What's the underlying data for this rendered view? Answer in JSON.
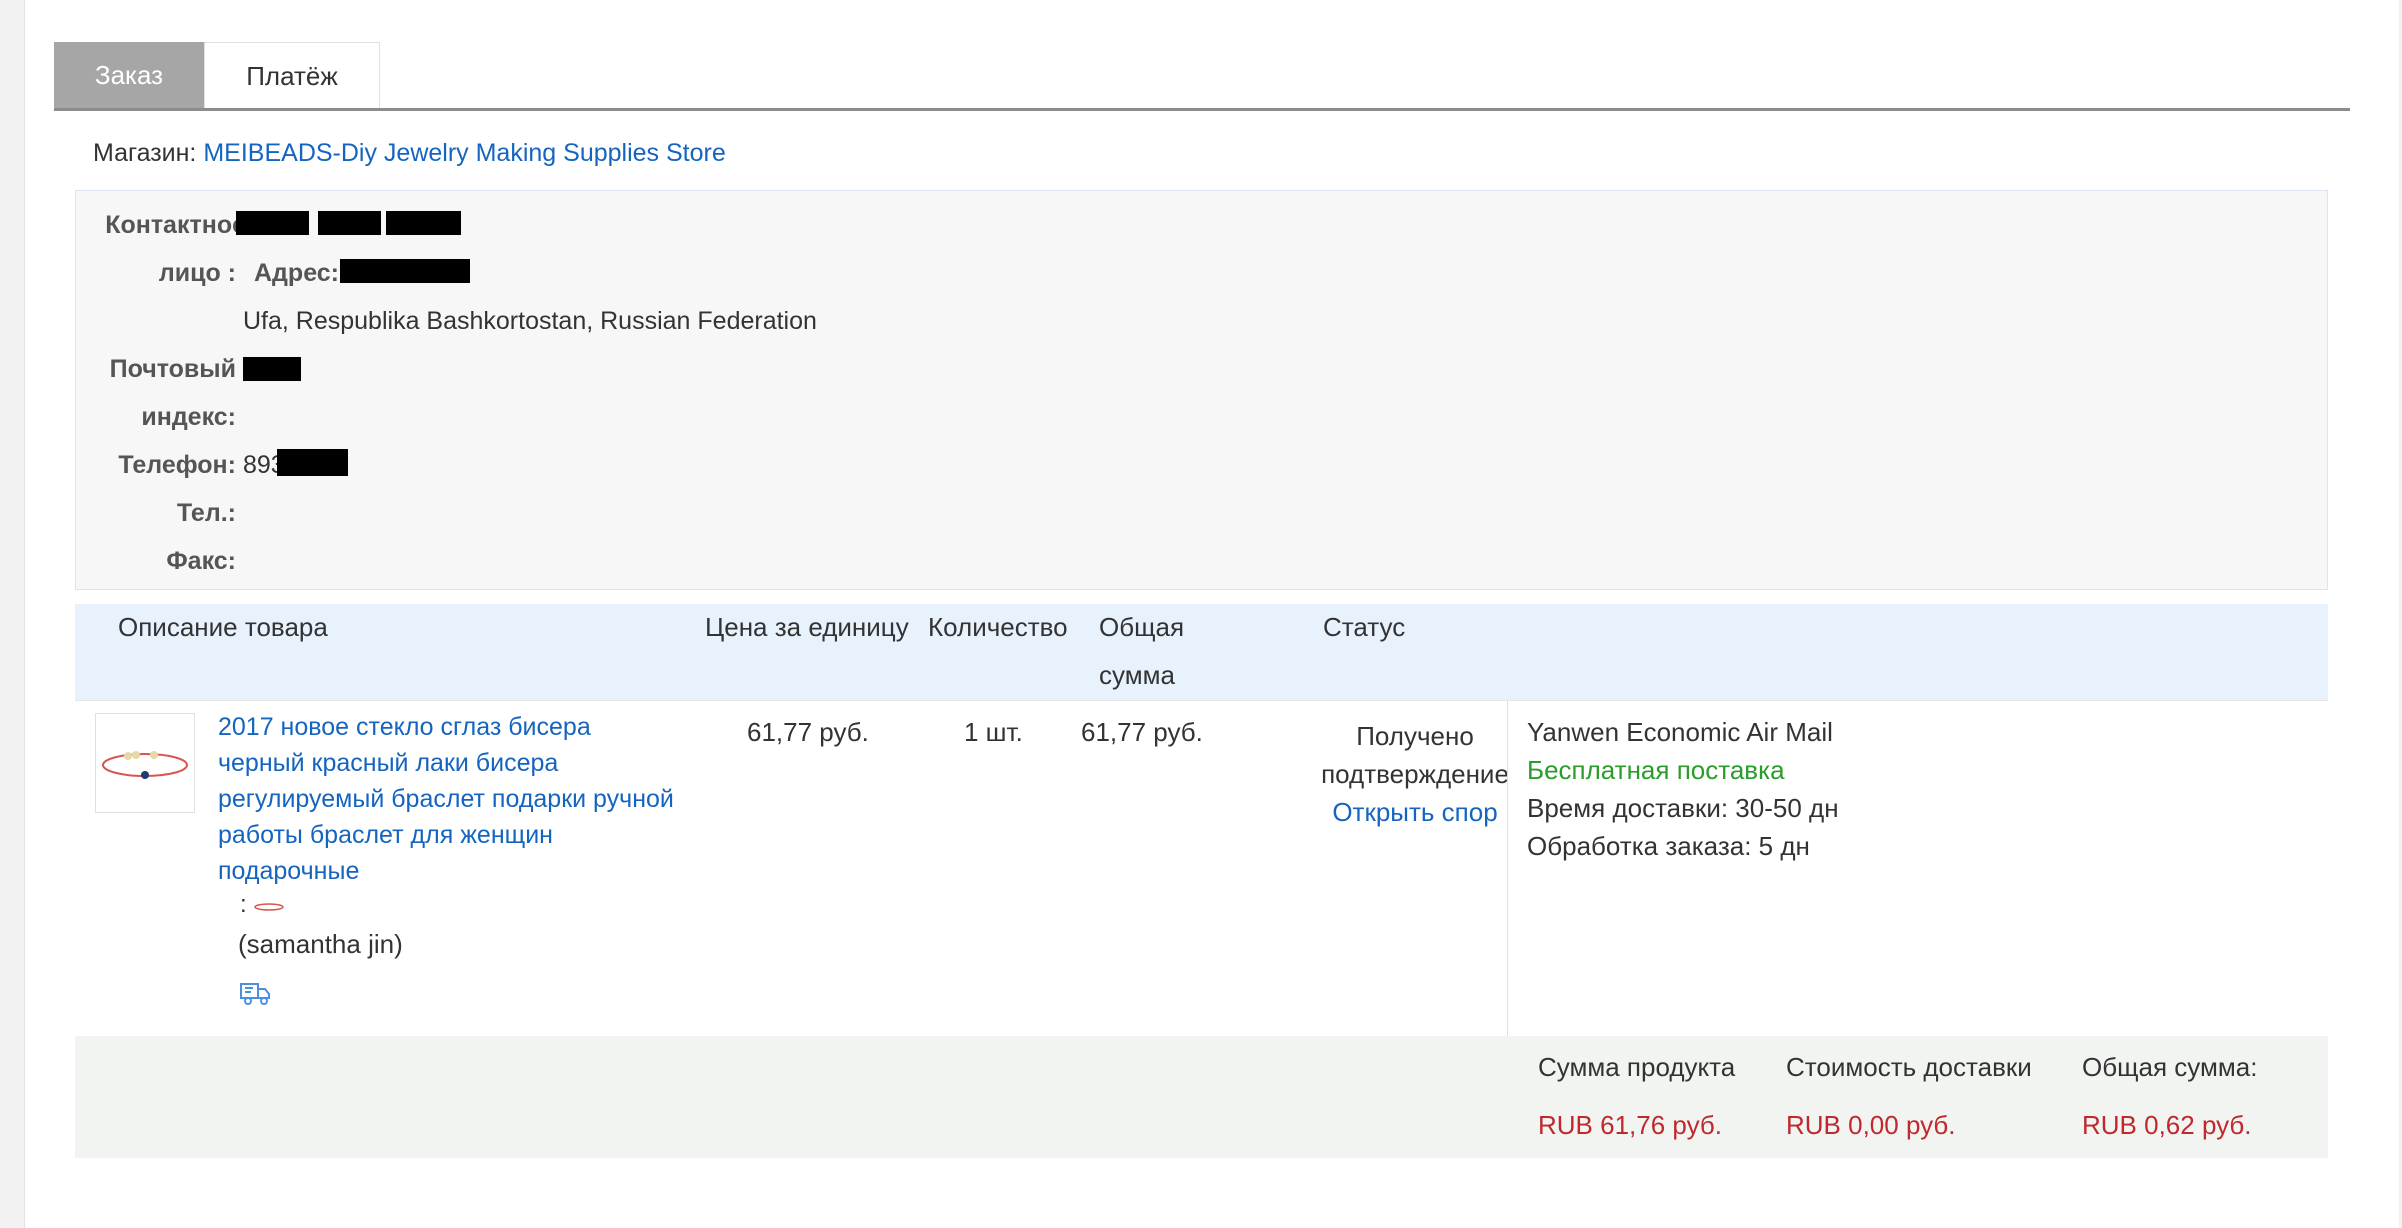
{
  "tabs": [
    {
      "label": "Заказ",
      "active": true
    },
    {
      "label": "Платёж",
      "active": false
    }
  ],
  "store": {
    "label": "Магазин:",
    "name": "MEIBEADS-Diy Jewelry Making Supplies Store"
  },
  "contact": {
    "contact_label": "Контактное",
    "person_label": "лицо :",
    "address_label": "Адрес:",
    "address_line2": "Ufa, Respublika Bashkortostan, Russian Federation",
    "postal_label_1": "Почтовый",
    "postal_label_2": "индекс:",
    "phone_label": "Телефон:",
    "phone_value": "8937",
    "tel_label": "Тел.:",
    "fax_label": "Факс:"
  },
  "table": {
    "headers": {
      "description": "Описание товара",
      "unit_price": "Цена за единицу",
      "quantity": "Количество",
      "total_1": "Общая",
      "total_2": "сумма",
      "status": "Статус"
    },
    "item": {
      "title": "2017 новое стекло сглаз бисера черный красный лаки бисера регулируемый браслет подарки ручной работы браслет для женщин подарочные",
      "variant_prefix": ":",
      "seller": "(samantha jin)",
      "unit_price": "61,77 руб.",
      "quantity": "1 шт.",
      "total": "61,77 руб.",
      "status_1": "Получено",
      "status_2": "подтверждение",
      "dispute": "Открыть спор",
      "shipping_method": "Yanwen Economic Air Mail",
      "shipping_cost": "Бесплатная поставка",
      "delivery_time": "Время доставки: 30-50 дн",
      "processing_time": "Обработка заказа: 5 дн"
    }
  },
  "totals": {
    "product_label": "Сумма продукта",
    "shipping_label": "Стоимость доставки",
    "total_label": "Общая сумма:",
    "product_value": "RUB 61,76 руб.",
    "shipping_value": "RUB 0,00 руб.",
    "total_value": "RUB 0,62 руб."
  },
  "colors": {
    "link": "#1565c0",
    "free_shipping": "#2a9d2a",
    "price": "#c0282d",
    "header_bg": "#e8f2fd"
  },
  "icons": {
    "shipping": "delivery-truck-icon"
  }
}
